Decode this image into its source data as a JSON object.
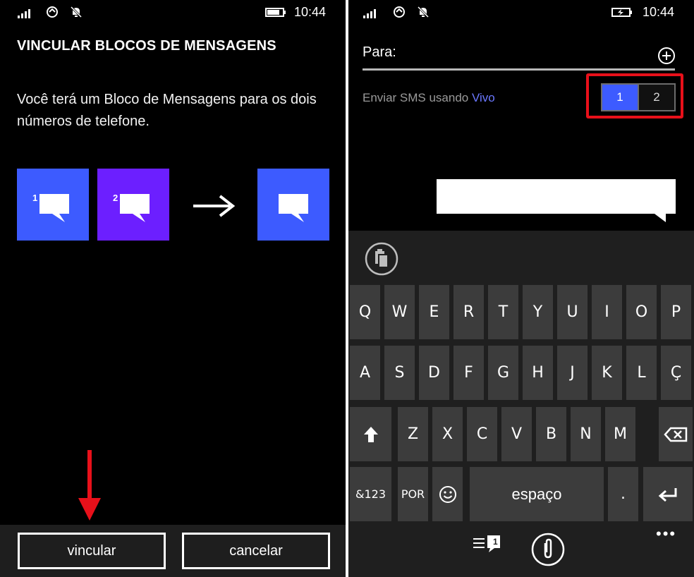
{
  "left_screen": {
    "status": {
      "time": "10:44"
    },
    "title": "VINCULAR BLOCOS DE MENSAGENS",
    "description": "Você terá um Bloco de Mensagens para os dois números de telefone.",
    "tiles": [
      {
        "number": "1",
        "color": "#3d5bff"
      },
      {
        "number": "2",
        "color": "#6c1fff"
      }
    ],
    "result_tile_color": "#3d5bff",
    "buttons": {
      "link": "vincular",
      "cancel": "cancelar"
    },
    "annotation_color": "#e8101a"
  },
  "right_screen": {
    "status": {
      "time": "10:44"
    },
    "to_label": "Para:",
    "sms_prefix": "Enviar SMS usando",
    "carrier": "Vivo",
    "sim_options": [
      "1",
      "2"
    ],
    "sim_selected": "1",
    "highlight_color": "#e8101a",
    "keyboard": {
      "row1": [
        "Q",
        "W",
        "E",
        "R",
        "T",
        "Y",
        "U",
        "I",
        "O",
        "P"
      ],
      "row2": [
        "A",
        "S",
        "D",
        "F",
        "G",
        "H",
        "J",
        "K",
        "L",
        "Ç"
      ],
      "row3": [
        "Z",
        "X",
        "C",
        "V",
        "B",
        "N",
        "M"
      ],
      "shift_icon": "shift-arrow-icon",
      "backspace_icon": "backspace-icon",
      "num_key": "&123",
      "lang_key": "POR",
      "emoji_icon": "smiley-icon",
      "space": "espaço",
      "period": ".",
      "enter_icon": "enter-icon"
    },
    "app_bar": {
      "sim_switch_badge": "1",
      "more": "•••"
    }
  }
}
